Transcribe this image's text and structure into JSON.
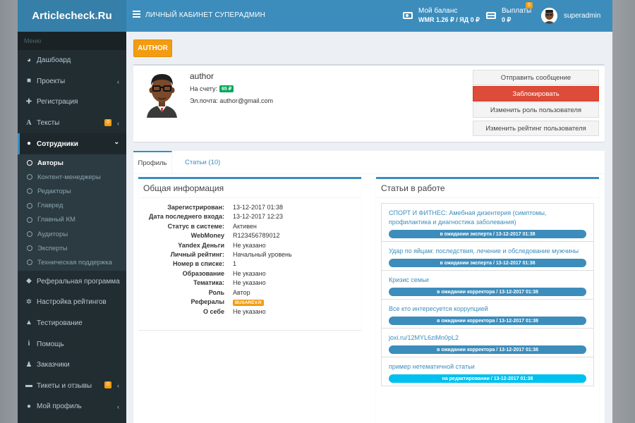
{
  "header": {
    "logo": "Articlecheck.Ru",
    "title": "ЛИЧНЫЙ КАБИНЕТ СУПЕРАДМИН",
    "balance_label": "Мой баланс",
    "balance_value": "WMR 1.26 ₽ / ЯД 0 ₽",
    "payouts_label": "Выплаты",
    "payouts_value": "0 ₽",
    "payouts_badge": "0",
    "username": "superadmin"
  },
  "sidebar": {
    "menu_title": "Меню",
    "items_top": [
      {
        "label": "Дашбоард",
        "icon": "dashboard-icon"
      },
      {
        "label": "Проекты",
        "icon": "folder-icon",
        "chevron": "‹"
      },
      {
        "label": "Регистрация",
        "icon": "user-plus-icon"
      },
      {
        "label": "Тексты",
        "icon": "font-icon",
        "count": "0",
        "chevron": "‹"
      },
      {
        "label": "Сотрудники",
        "icon": "users-icon",
        "chevron": "⌄"
      }
    ],
    "submenu": [
      "Авторы",
      "Контент-менеджеры",
      "Редакторы",
      "Главред",
      "Главный КМ",
      "Аудиторы",
      "Эксперты",
      "Техническая поддержка"
    ],
    "items_bottom": [
      {
        "label": "Реферальная программа",
        "icon": "diamond-icon"
      },
      {
        "label": "Настройка рейтингов",
        "icon": "cogs-icon"
      },
      {
        "label": "Тестирование",
        "icon": "graduation-cap-icon"
      },
      {
        "label": "Помощь",
        "icon": "info-icon"
      },
      {
        "label": "Заказчики",
        "icon": "male-icon"
      },
      {
        "label": "Тикеты и отзывы",
        "icon": "ticket-icon",
        "count": "0",
        "chevron": "‹"
      },
      {
        "label": "Мой профиль",
        "icon": "user-icon",
        "chevron": "‹"
      }
    ]
  },
  "page": {
    "role_button": "AUTHOR",
    "user": {
      "name": "author",
      "account_label": "На счету:",
      "account_value": "65 ₽",
      "email_line": "Эл.почта: author@gmail.com"
    },
    "actions": [
      "Отправить сообщение",
      "Заблокировать",
      "Изменить роль пользователя",
      "Изменить рейтинг пользователя"
    ],
    "tabs": [
      "Профиль",
      "Статьи (10)"
    ]
  },
  "info": {
    "title": "Общая информация",
    "rows": [
      {
        "k": "Зарегистрирован:",
        "v": "13-12-2017 01:38"
      },
      {
        "k": "Дата последнего входа:",
        "v": "13-12-2017 12:23"
      },
      {
        "k": "Статус в системе:",
        "v": "Активен"
      },
      {
        "k": "WebMoney",
        "v": "R123456789012"
      },
      {
        "k": "Yandex Деньги",
        "v": "Не указано"
      },
      {
        "k": "Личный рейтинг:",
        "v": "Начальный уровень"
      },
      {
        "k": "Номер в списке:",
        "v": "1"
      },
      {
        "k": "Образование",
        "v": "Не указано"
      },
      {
        "k": "Тематика:",
        "v": "Не указано"
      },
      {
        "k": "Роль",
        "v": "Автор"
      },
      {
        "k": "Рефералы",
        "v": "BUSAREV.R"
      },
      {
        "k": "О себе",
        "v": "Не указано"
      }
    ]
  },
  "articles": {
    "title": "Статьи в работе",
    "items": [
      {
        "title": "СПОРТ И ФИТНЕС: Амебная дизентерия (симптомы, профилактика и диагностика заболевания)",
        "status": "в ожидании эксперта / 13-12-2017 01:38"
      },
      {
        "title": "Удар по яйцам: последствия, лечение и обследование мужчины",
        "status": "в ожидании эксперта / 13-12-2017 01:38"
      },
      {
        "title": "Кризис семьи",
        "status": "в ожидании корректора / 13-12-2017 01:38"
      },
      {
        "title": "Все кто интересуется коррупцией",
        "status": "в ожидании корректора / 13-12-2017 01:38"
      },
      {
        "title": "joxi.ru/12MYL6ziMn0pL2",
        "status": "в ожидании корректора / 13-12-2017 01:38"
      },
      {
        "title": "пример нетематичной статьи",
        "status": "на редактировании / 13-12-2017 01:38"
      }
    ]
  },
  "colors": {
    "primary": "#3c8dbc",
    "danger": "#dd4b39",
    "warning": "#f39c12",
    "success": "#00a65a",
    "aqua": "#00c0ef",
    "sidebar": "#222d32"
  }
}
